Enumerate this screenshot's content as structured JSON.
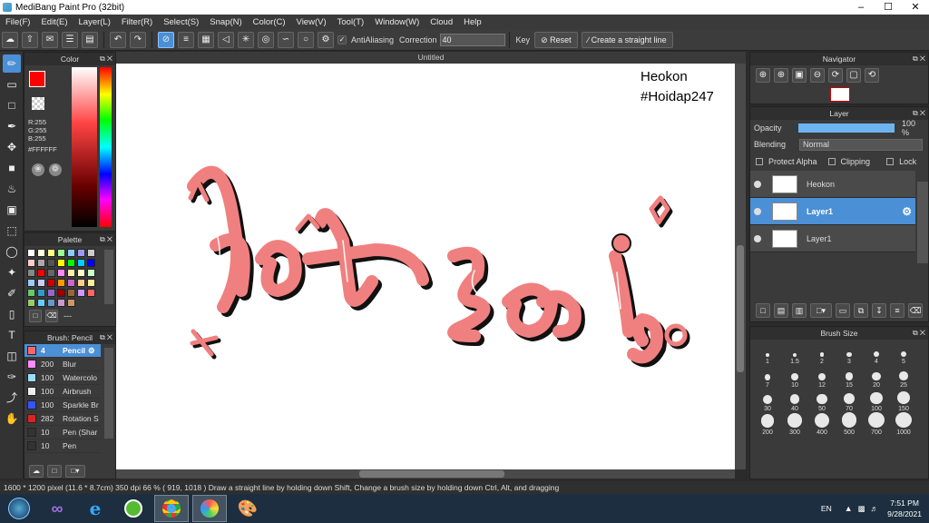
{
  "window": {
    "title": "MediBang Paint Pro (32bit)"
  },
  "menu": [
    "File(F)",
    "Edit(E)",
    "Layer(L)",
    "Filter(R)",
    "Select(S)",
    "Snap(N)",
    "Color(C)",
    "View(V)",
    "Tool(T)",
    "Window(W)",
    "Cloud",
    "Help"
  ],
  "toolbar": {
    "antialias_label": "AntiAliasing",
    "correction_label": "Correction",
    "correction_value": "40",
    "key_label": "Key",
    "reset_label": "Reset",
    "straight_line_label": "Create a straight line"
  },
  "color_panel": {
    "title": "Color",
    "r": "R:255",
    "g": "G:255",
    "b": "B:255",
    "hex": "#FFFFFF",
    "fg": "#ff0000",
    "bg": "#ffffff"
  },
  "palette_panel": {
    "title": "Palette",
    "footer": "---",
    "colors": [
      "#fff",
      "#ffd",
      "#ff8",
      "#9f9",
      "#8cf",
      "#99f",
      "#ccc",
      "#fcc",
      "#aaa",
      "#555",
      "#ff0",
      "#0f0",
      "#0cf",
      "#00f",
      "#888",
      "#f00",
      "#666",
      "#f8f",
      "#fea",
      "#ffc",
      "#cfc",
      "#9cf",
      "#ccf",
      "#c00",
      "#f90",
      "#c6c",
      "#fc8",
      "#fe9",
      "#6c6",
      "#39c",
      "#96c",
      "#900",
      "#963",
      "#c9f",
      "#f66",
      "#9c6",
      "#6cf",
      "#69c",
      "#c9c",
      "#c96"
    ]
  },
  "brush_panel": {
    "title": "Brush: Pencil",
    "brushes": [
      {
        "size": "4",
        "name": "Pencil",
        "color": "#ff6666",
        "active": true
      },
      {
        "size": "200",
        "name": "Blur",
        "color": "#ff8cff"
      },
      {
        "size": "100",
        "name": "Watercolo",
        "color": "#99ddff"
      },
      {
        "size": "100",
        "name": "Airbrush",
        "color": "#eeeeee"
      },
      {
        "size": "100",
        "name": "Sparkle Br",
        "color": "#3355ff"
      },
      {
        "size": "282",
        "name": "Rotation S",
        "color": "#dd2222"
      },
      {
        "size": "10",
        "name": "Pen (Shar",
        "color": "#333333"
      },
      {
        "size": "10",
        "name": "Pen",
        "color": "#333333"
      }
    ]
  },
  "canvas": {
    "tab": "Untitled",
    "watermark_line1": "Heokon",
    "watermark_line2": "#Hoidap247"
  },
  "navigator": {
    "title": "Navigator"
  },
  "layer_panel": {
    "title": "Layer",
    "opacity_label": "Opacity",
    "opacity_value": "100 %",
    "opacity_fraction": 1.0,
    "blending_label": "Blending",
    "blending_value": "Normal",
    "protect_alpha": "Protect Alpha",
    "clipping": "Clipping",
    "lock": "Lock",
    "layers": [
      {
        "name": "Heokon",
        "active": false
      },
      {
        "name": "Layer1",
        "active": true
      },
      {
        "name": "Layer1",
        "active": false
      }
    ]
  },
  "brush_size_panel": {
    "title": "Brush Size",
    "sizes": [
      "1",
      "1.5",
      "2",
      "3",
      "4",
      "5",
      "7",
      "10",
      "12",
      "15",
      "20",
      "25",
      "30",
      "40",
      "50",
      "70",
      "100",
      "150",
      "200",
      "300",
      "400",
      "500",
      "700",
      "1000"
    ]
  },
  "status": {
    "text": "1600 * 1200 pixel  (11.6 * 8.7cm)  350 dpi  66 %  ( 919, 1018 )  Draw a straight line by holding down Shift, Change a brush size by holding down Ctrl, Alt, and dragging"
  },
  "taskbar": {
    "lang": "EN",
    "time": "7:51 PM",
    "date": "9/28/2021"
  },
  "colors": {
    "accent": "#4b8fd6",
    "stroke_pink": "#f08080"
  }
}
